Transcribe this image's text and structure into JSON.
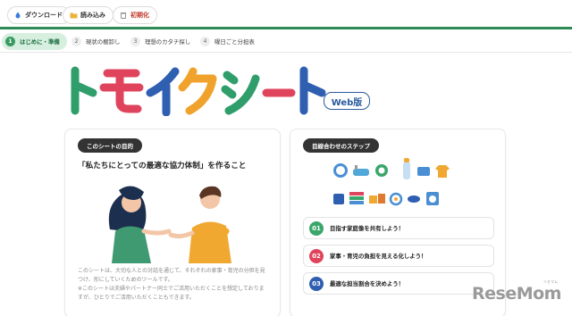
{
  "toolbar": {
    "download_label": "ダウンロード",
    "load_label": "読み込み",
    "reset_label": "初期化"
  },
  "steps": [
    {
      "num": "1",
      "label": "はじめに・準備"
    },
    {
      "num": "2",
      "label": "現状の棚卸し"
    },
    {
      "num": "3",
      "label": "理想のカタチ探し"
    },
    {
      "num": "4",
      "label": "曜日ごと分担表"
    }
  ],
  "logo": {
    "text": "トモイクシート",
    "badge": "Web版",
    "colors": [
      "#2f9e6b",
      "#e0445c",
      "#2f5fb0",
      "#f0a22c",
      "#2f9e6b",
      "#e0445c",
      "#2f5fb0"
    ]
  },
  "left_card": {
    "pill": "このシートの目的",
    "title": "「私たちにとっての最適な協力体制」を作ること",
    "desc1": "このシートは、大切な人との対話を通じて、それぞれの家事・育児の分担を見",
    "desc2": "つけ、形にしていくためのツールです。",
    "desc3": "※このシートは夫婦やパートナー同士でご活用いただくことを想定しておりま",
    "desc4": "すが、ひとりでご活用いただくこともできます。"
  },
  "right_card": {
    "pill": "目線合わせのステップ",
    "items": [
      {
        "num": "01",
        "label": "目指す家庭像を共有しよう！",
        "color": "#3aa66b"
      },
      {
        "num": "02",
        "label": "家事・育児の負担を見える化しよう！",
        "color": "#e0445c"
      },
      {
        "num": "03",
        "label": "最適な担当割合を決めよう！",
        "color": "#2f5fb0"
      }
    ]
  },
  "watermark": {
    "main": "ReseMom",
    "ruby": "リセマム"
  }
}
